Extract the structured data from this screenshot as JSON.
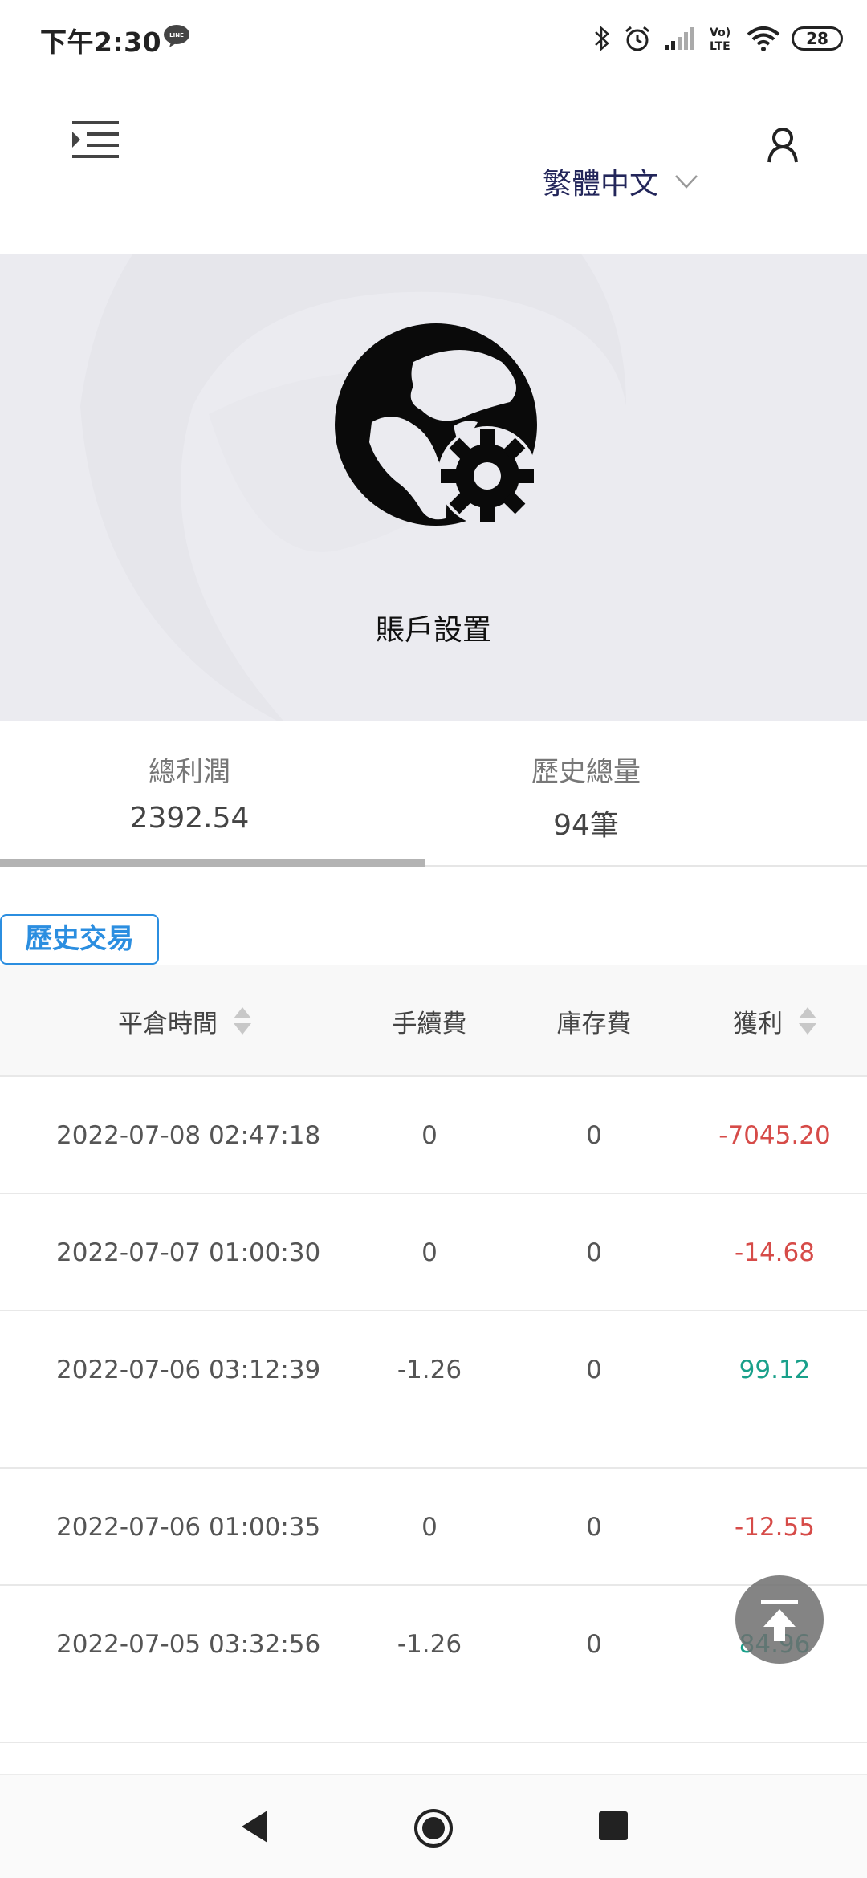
{
  "status_bar": {
    "time": "下午2:30",
    "battery": "28",
    "icons": [
      "line-app-icon",
      "bluetooth-icon",
      "alarm-icon",
      "signal-icon",
      "volte-icon",
      "wifi-icon",
      "battery-icon"
    ],
    "volte_text": "Vo)) LTE"
  },
  "header": {
    "menu_icon": "menu-indent-icon",
    "language": "繁體中文",
    "dropdown_icon": "chevron-down-icon",
    "user_icon": "user-icon"
  },
  "hero": {
    "icon": "account-settings-globe-gear-icon",
    "label": "賬戶設置"
  },
  "stats": {
    "profit_title": "總利潤",
    "profit_value": "2392.54",
    "history_title": "歷史總量",
    "history_value": "94筆",
    "active_tab": "profit"
  },
  "section": {
    "label": "歷史交易"
  },
  "table": {
    "headers": {
      "close_time": "平倉時間",
      "fee": "手續費",
      "storage_fee": "庫存費",
      "profit": "獲利"
    },
    "rows": [
      {
        "time": "2022-07-08 02:47:18",
        "fee": "0",
        "storage": "0",
        "profit": "-7045.20",
        "sign": "neg"
      },
      {
        "time": "2022-07-07 01:00:30",
        "fee": "0",
        "storage": "0",
        "profit": "-14.68",
        "sign": "neg"
      },
      {
        "time": "2022-07-06 03:12:39",
        "fee": "-1.26",
        "storage": "0",
        "profit": "99.12",
        "sign": "pos"
      },
      {
        "time": "2022-07-06 01:00:35",
        "fee": "0",
        "storage": "0",
        "profit": "-12.55",
        "sign": "neg"
      },
      {
        "time": "2022-07-05 03:32:56",
        "fee": "-1.26",
        "storage": "0",
        "profit": "84.96",
        "sign": "pos"
      }
    ]
  },
  "colors": {
    "accent": "#2b8ee0",
    "negative": "#d64b48",
    "positive": "#19a08a",
    "hero_bg": "#ebebf0",
    "language_text": "#23265a"
  },
  "nav_bar": {
    "icons": [
      "back-icon",
      "home-icon",
      "recent-apps-icon"
    ]
  }
}
